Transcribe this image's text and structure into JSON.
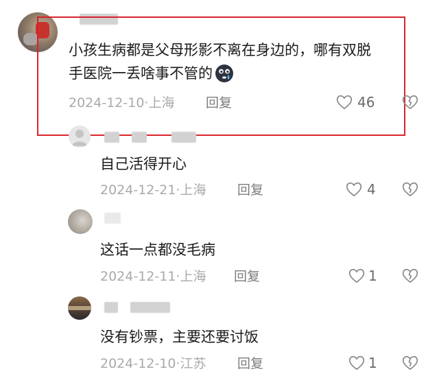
{
  "comments": [
    {
      "text": "小孩生病都是父母形影不离在身边的，哪有双脱手医院一丢啥事不管的",
      "text_line1": "小孩生病都是父母形影不离在身边的，哪有双脱",
      "text_line2": "手医院一丢啥事不管的",
      "emoji": "crying-face-emoji",
      "date": "2024-12-10",
      "location": "上海",
      "reply_label": "回复",
      "likes": "46",
      "highlighted": true,
      "highlight_color": "#d8232a"
    },
    {
      "text": "自己活得开心",
      "date": "2024-12-21",
      "location": "上海",
      "reply_label": "回复",
      "likes": "4"
    },
    {
      "text": "这话一点都没毛病",
      "date": "2024-12-11",
      "location": "上海",
      "reply_label": "回复",
      "likes": "1"
    },
    {
      "text": "没有钞票，主要还要讨饭",
      "date": "2024-12-10",
      "location": "江苏",
      "reply_label": "回复",
      "likes": "1"
    }
  ],
  "icons": {
    "like": "heart-outline-icon",
    "dislike": "broken-heart-icon"
  }
}
